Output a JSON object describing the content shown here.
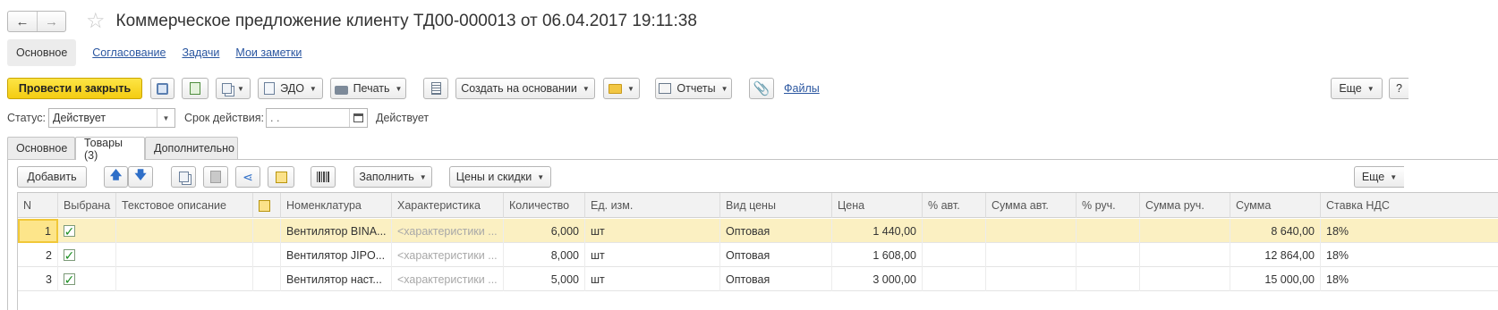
{
  "header": {
    "back_icon": "←",
    "forward_icon": "→",
    "star_icon": "☆",
    "title": "Коммерческое предложение клиенту ТД00-000013 от 06.04.2017 19:11:38"
  },
  "section_tabs": [
    "Основное",
    "Согласование",
    "Задачи",
    "Мои заметки"
  ],
  "toolbar": {
    "post_close": "Провести и закрыть",
    "edo": "ЭДО",
    "print": "Печать",
    "create_based": "Создать на основании",
    "reports": "Отчеты",
    "files": "Файлы",
    "more": "Еще",
    "help": "?"
  },
  "status": {
    "status_label": "Статус:",
    "status_value": "Действует",
    "validity_label": "Срок действия:",
    "validity_value": " .  .",
    "validity_text": "Действует"
  },
  "page_tabs": [
    "Основное",
    "Товары (3)",
    "Дополнительно"
  ],
  "goods_toolbar": {
    "add": "Добавить",
    "fill": "Заполнить",
    "prices": "Цены и скидки",
    "more": "Еще"
  },
  "table": {
    "columns": [
      "N",
      "Выбрана",
      "Текстовое описание",
      "",
      "Номенклатура",
      "Характеристика",
      "Количество",
      "Ед. изм.",
      "Вид цены",
      "Цена",
      "% авт.",
      "Сумма авт.",
      "% руч.",
      "Сумма руч.",
      "Сумма",
      "Ставка НДС"
    ],
    "rows": [
      {
        "n": "1",
        "checked": "✓",
        "text_desc": "",
        "item": "Вентилятор BINA...",
        "characteristic": "<характеристики ...",
        "qty": "6,000",
        "unit": "шт",
        "price_type": "Оптовая",
        "price": "1 440,00",
        "pct_auto": "",
        "sum_auto": "",
        "pct_manual": "",
        "sum_manual": "",
        "sum": "8 640,00",
        "vat": "18%"
      },
      {
        "n": "2",
        "checked": "✓",
        "text_desc": "",
        "item": "Вентилятор JIPO...",
        "characteristic": "<характеристики ...",
        "qty": "8,000",
        "unit": "шт",
        "price_type": "Оптовая",
        "price": "1 608,00",
        "pct_auto": "",
        "sum_auto": "",
        "pct_manual": "",
        "sum_manual": "",
        "sum": "12 864,00",
        "vat": "18%"
      },
      {
        "n": "3",
        "checked": "✓",
        "text_desc": "",
        "item": "Вентилятор наст...",
        "characteristic": "<характеристики ...",
        "qty": "5,000",
        "unit": "шт",
        "price_type": "Оптовая",
        "price": "3 000,00",
        "pct_auto": "",
        "sum_auto": "",
        "pct_manual": "",
        "sum_manual": "",
        "sum": "15 000,00",
        "vat": "18%"
      }
    ]
  },
  "colors": {
    "accent_yellow": "#f4cc12",
    "link_blue": "#2a56a0",
    "selected_row": "#fbf0c2",
    "check_green": "#1c8f22"
  }
}
